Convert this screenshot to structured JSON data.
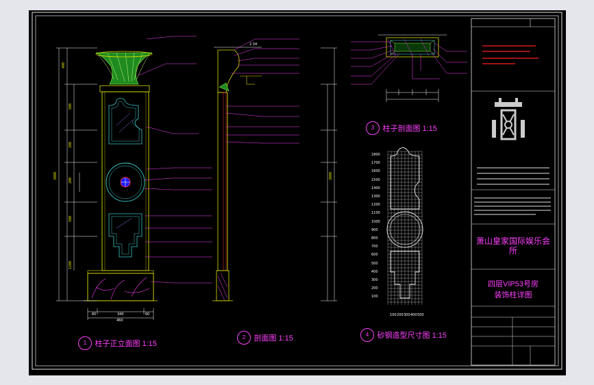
{
  "drawing": {
    "views": {
      "elevation": {
        "title": "柱子正立面图 1:15",
        "num": "1"
      },
      "section": {
        "title": "剖面图 1:15",
        "num": "2"
      },
      "column_section": {
        "title": "柱子剖面图 1:15",
        "num": "3"
      },
      "steel_template": {
        "title": "砂钢造型尺寸图 1:15",
        "num": "4"
      }
    },
    "dims": {
      "elev_bottom": [
        "60",
        "340",
        "60"
      ],
      "elev_bottom_total": "460",
      "elev_left": [
        "400",
        "500",
        "200",
        "200",
        "500",
        "1200"
      ],
      "elev_total": "3000",
      "sect_top": "2.34",
      "template_rows": [
        "1800",
        "1700",
        "1600",
        "1500",
        "1400",
        "1300",
        "1200",
        "1100",
        "1000",
        "900",
        "800",
        "700",
        "600",
        "500",
        "400",
        "300",
        "200",
        "100"
      ],
      "template_cols": [
        "100",
        "200",
        "300",
        "400",
        "500"
      ]
    }
  },
  "title_block": {
    "project": "萧山皇家国际娱乐会所",
    "drawing_name_1": "四层VIP53号房",
    "drawing_name_2": "装饰柱详图"
  }
}
